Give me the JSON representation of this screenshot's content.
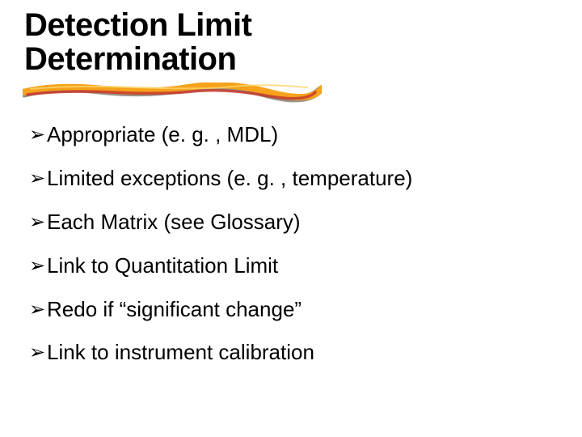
{
  "title_line1": "Detection Limit",
  "title_line2": "Determination",
  "bullets": [
    "Appropriate (e. g. , MDL)",
    "Limited exceptions (e. g. , temperature)",
    "Each Matrix (see Glossary)",
    "Link to Quantitation Limit",
    "Redo if “significant change”",
    "Link to instrument calibration"
  ],
  "bullet_marker": "➢",
  "accent_colors": {
    "orange": "#f6a21a",
    "red": "#c63a2e",
    "shadow": "#4a3b1e"
  }
}
